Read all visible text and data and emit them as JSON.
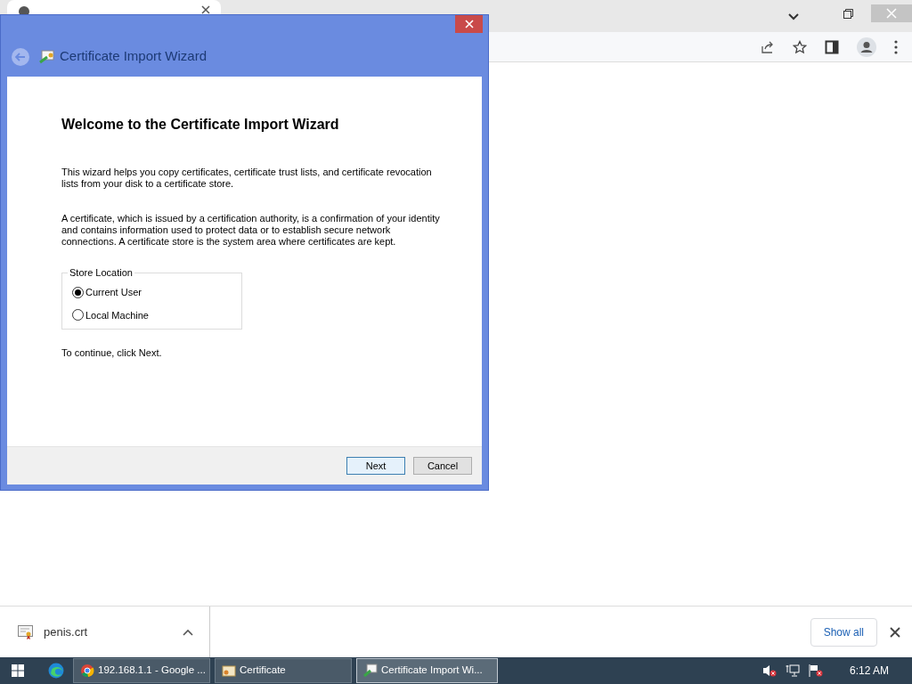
{
  "dialog": {
    "title": "Certificate Import Wizard",
    "heading": "Welcome to the Certificate Import Wizard",
    "paragraphs": [
      "This wizard helps you copy certificates, certificate trust lists, and certificate revocation lists from your disk to a certificate store.",
      "A certificate, which is issued by a certification authority, is a confirmation of your identity and contains information used to protect data or to establish secure network connections. A certificate store is the system area where certificates are kept."
    ],
    "store_location": {
      "label": "Store Location",
      "options": [
        {
          "label": "Current User",
          "selected": true
        },
        {
          "label": "Local Machine",
          "selected": false
        }
      ]
    },
    "hint": "To continue, click Next.",
    "buttons": [
      {
        "label": "Next",
        "kind": "default"
      },
      {
        "label": "Cancel",
        "kind": "normal"
      }
    ]
  },
  "download_bar": {
    "file": "penis.crt",
    "show_all": "Show all"
  },
  "taskbar": {
    "items": [
      {
        "label": "192.168.1.1 - Google ...",
        "kind": "chrome",
        "selected": false
      },
      {
        "label": "Certificate",
        "kind": "cert",
        "selected": false
      },
      {
        "label": "Certificate Import Wi...",
        "kind": "wizard",
        "selected": true
      }
    ],
    "clock": "6:12 AM"
  }
}
